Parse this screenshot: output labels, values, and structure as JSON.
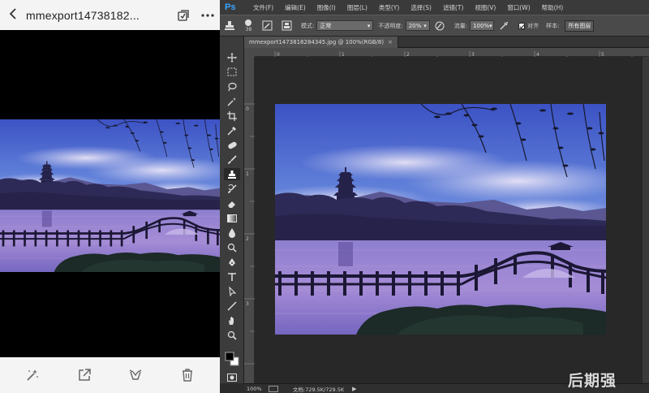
{
  "phone": {
    "title": "mmexport14738182...",
    "top_icons": [
      "back-icon",
      "select-icon",
      "more-icon"
    ],
    "bottom_icons": [
      "magic-wand-icon",
      "share-icon",
      "recycle-icon",
      "trash-icon"
    ]
  },
  "photoshop": {
    "logo": "Ps",
    "menu": [
      "文件(F)",
      "编辑(E)",
      "图像(I)",
      "图层(L)",
      "类型(Y)",
      "选择(S)",
      "滤镜(T)",
      "视图(V)",
      "窗口(W)",
      "帮助(H)"
    ],
    "options": {
      "brush_size": "38",
      "mode_label": "模式:",
      "mode_value": "正常",
      "opacity_label": "不透明度:",
      "opacity_value": "20%",
      "flow_label": "流量:",
      "flow_value": "100%",
      "aligned_label": "对齐",
      "sample_label": "样本:",
      "sample_value": "所有图层"
    },
    "document_tab": "mmexport1473818284345.jpg @ 100%(RGB/8)",
    "status": {
      "zoom": "100%",
      "doc_size": "文档:729.5K/729.5K"
    },
    "accent_color": "#3aa6ff"
  },
  "watermark": "后期强"
}
